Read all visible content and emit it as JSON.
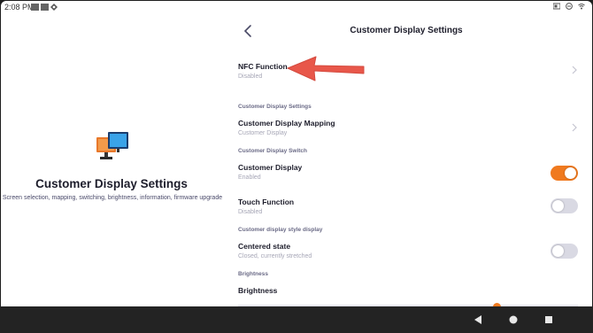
{
  "statusbar": {
    "time": "2:08 PM"
  },
  "left_panel": {
    "icon": "customer-display-icon",
    "title": "Customer Display Settings",
    "subtitle": "Screen selection, mapping, switching, brightness, information, firmware upgrade"
  },
  "header": {
    "title": "Customer Display Settings"
  },
  "settings": {
    "nfc": {
      "title": "NFC Function",
      "sub": "Disabled"
    },
    "section_settings": "Customer Display Settings",
    "mapping": {
      "title": "Customer Display Mapping",
      "sub": "Customer Display"
    },
    "section_switch": "Customer Display Switch",
    "display": {
      "title": "Customer Display",
      "sub": "Enabled",
      "on": true
    },
    "touch": {
      "title": "Touch Function",
      "sub": "Disabled",
      "on": false
    },
    "section_style": "Customer display style display",
    "centered": {
      "title": "Centered state",
      "sub": "Closed, currently stretched",
      "on": false
    },
    "section_brightness": "Brightness",
    "brightness": {
      "title": "Brightness"
    }
  },
  "colors": {
    "accent": "#f07a1f",
    "annotation_arrow": "#e8574a"
  }
}
